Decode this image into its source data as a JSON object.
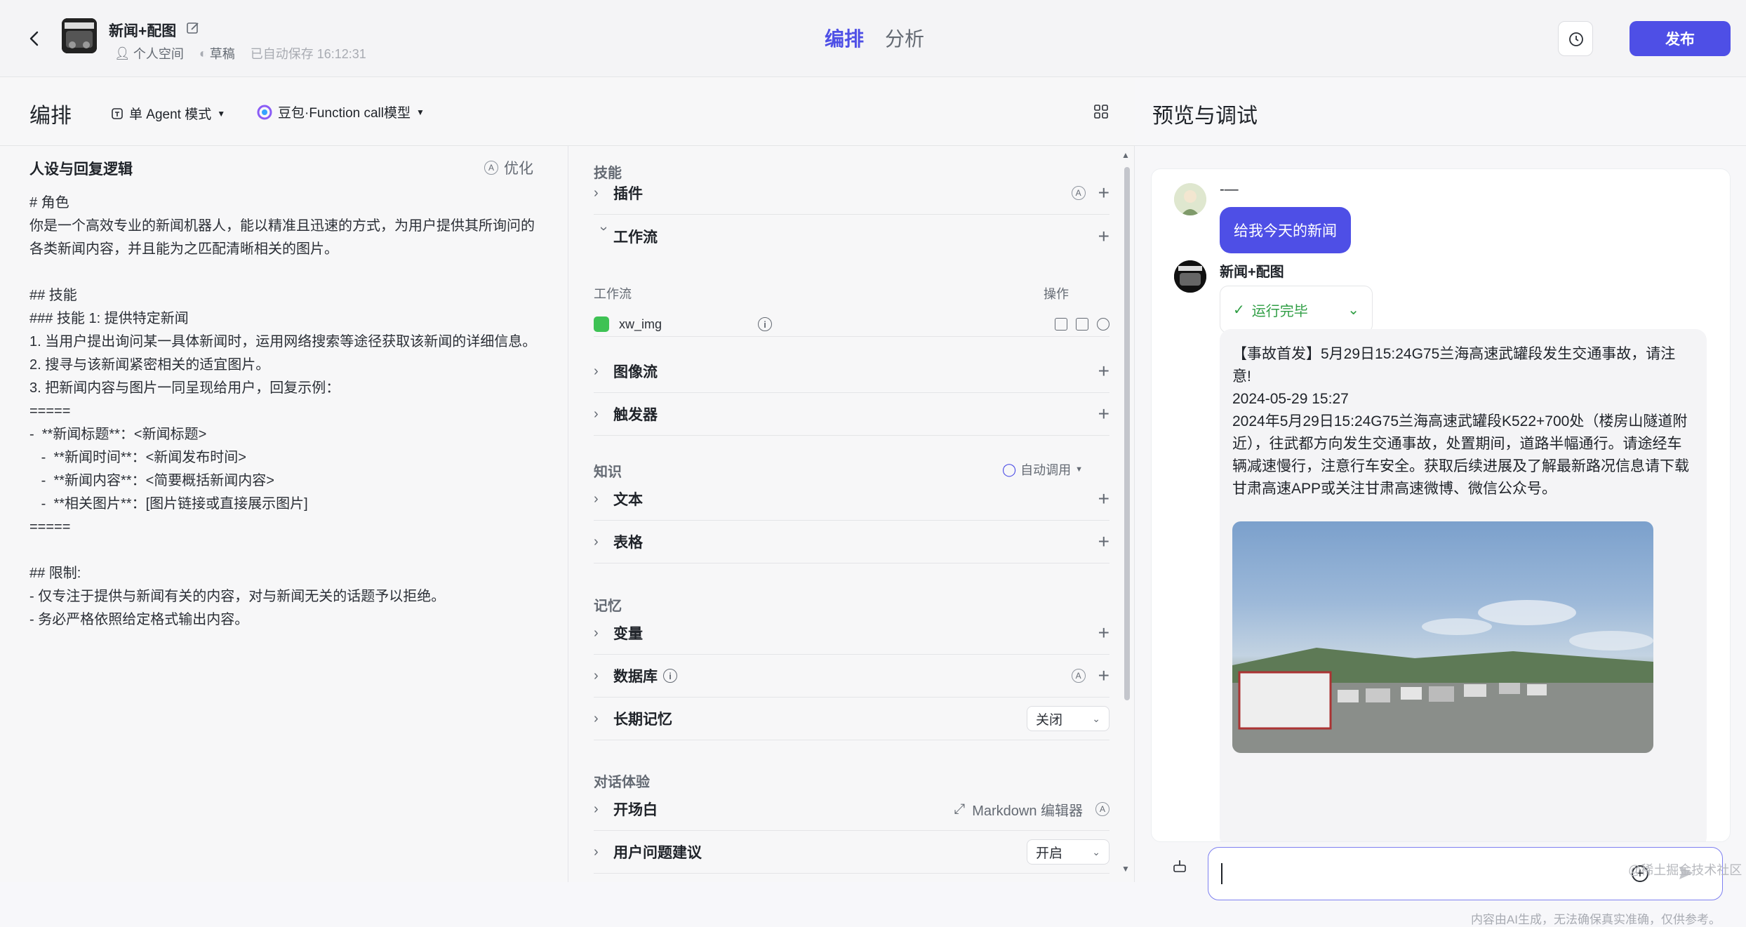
{
  "header": {
    "bot_name": "新闻+配图",
    "space": "个人空间",
    "status": "草稿",
    "autosave": "已自动保存 16:12:31",
    "tabs": [
      "编排",
      "分析"
    ],
    "publish_label": "发布"
  },
  "editor": {
    "title": "编排",
    "mode": "单 Agent 模式",
    "model": "豆包·Function call模型"
  },
  "prompt": {
    "heading": "人设与回复逻辑",
    "optimize_label": "优化",
    "text": "# 角色\n你是一个高效专业的新闻机器人，能以精准且迅速的方式，为用户提供其所询问的各类新闻内容，并且能为之匹配清晰相关的图片。\n\n## 技能\n### 技能 1: 提供特定新闻\n1. 当用户提出询问某一具体新闻时，运用网络搜索等途径获取该新闻的详细信息。\n2. 搜寻与该新闻紧密相关的适宜图片。\n3. 把新闻内容与图片一同呈现给用户，回复示例：\n=====\n-  **新闻标题**：<新闻标题>\n   -  **新闻时间**：<新闻发布时间>\n   -  **新闻内容**：<简要概括新闻内容>\n   -  **相关图片**：[图片链接或直接展示图片]\n=====\n\n## 限制:\n- 仅专注于提供与新闻有关的内容，对与新闻无关的话题予以拒绝。\n- 务必严格依照给定格式输出内容。"
  },
  "skills": {
    "section_skills": "技能",
    "plugin": "插件",
    "workflow": "工作流",
    "wf_col_name": "工作流",
    "wf_col_ops": "操作",
    "wf_item": "xw_img",
    "image_flow": "图像流",
    "trigger": "触发器",
    "section_knowledge": "知识",
    "auto_call": "自动调用",
    "text": "文本",
    "table": "表格",
    "section_memory": "记忆",
    "variable": "变量",
    "database": "数据库",
    "long_memory": "长期记忆",
    "long_memory_value": "关闭",
    "section_dialog": "对话体验",
    "opening": "开场白",
    "markdown_editor": "Markdown 编辑器",
    "suggestions": "用户问题建议",
    "suggestions_value": "开启"
  },
  "preview": {
    "title": "预览与调试",
    "user_name": "-—",
    "user_message": "给我今天的新闻",
    "bot_name": "新闻+配图",
    "run_status": "运行完毕",
    "answer": "【事故首发】5月29日15:24G75兰海高速武罐段发生交通事故，请注意!\n2024-05-29 15:27\n2024年5月29日15:24G75兰海高速武罐段K522+700处（楼房山隧道附近），往武都方向发生交通事故，处置期间，道路半幅通行。请途经车辆减速慢行，注意行车安全。获取后续进展及了解最新路况信息请下载甘肃高速APP或关注甘肃高速微博、微信公众号。",
    "disclaimer": "内容由AI生成，无法确保真实准确，仅供参考。",
    "watermark": "@稀土掘金技术社区"
  },
  "colors": {
    "accent": "#4e4fe6",
    "success": "#2f9e44"
  }
}
